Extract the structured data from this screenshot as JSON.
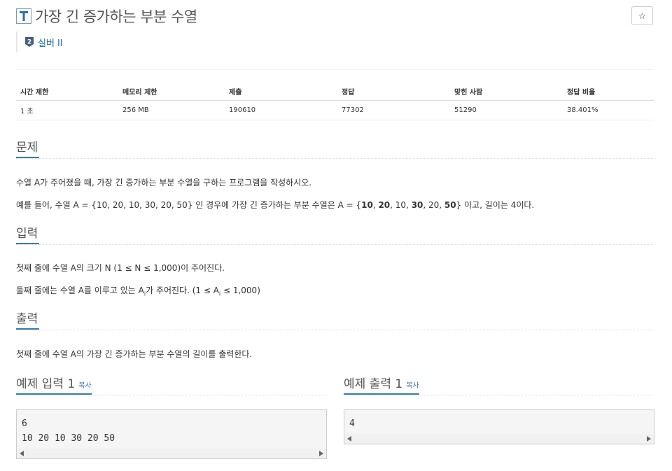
{
  "problem": {
    "title": "가장 긴 증가하는 부분 수열",
    "tier": "실버 II",
    "tier_number": "2",
    "star_glyph": "☆"
  },
  "info_table": {
    "headers": [
      "시간 제한",
      "메모리 제한",
      "제출",
      "정답",
      "맞힌 사람",
      "정답 비율"
    ],
    "values": [
      "1 초",
      "256 MB",
      "190610",
      "77302",
      "51290",
      "38.401%"
    ]
  },
  "sections": {
    "problem_heading": "문제",
    "problem_p1": "수열 A가 주어졌을 때, 가장 긴 증가하는 부분 수열을 구하는 프로그램을 작성하시오.",
    "problem_p2_prefix": "예를 들어, 수열 A = {10, 20, 10, 30, 20, 50} 인 경우에 가장 긴 증가하는 부분 수열은 A = {",
    "problem_p2_b1": "10",
    "problem_p2_s1": ", ",
    "problem_p2_b2": "20",
    "problem_p2_s2": ", 10, ",
    "problem_p2_b3": "30",
    "problem_p2_s3": ", 20, ",
    "problem_p2_b4": "50",
    "problem_p2_suffix": "} 이고, 길이는 4이다.",
    "input_heading": "입력",
    "input_p1": "첫째 줄에 수열 A의 크기 N (1 ≤ N ≤ 1,000)이 주어진다.",
    "input_p2_a": "둘째 줄에는 수열 A를 이루고 있는 A",
    "input_p2_sub1": "i",
    "input_p2_b": "가 주어진다. (1 ≤ A",
    "input_p2_sub2": "i",
    "input_p2_c": " ≤ 1,000)",
    "output_heading": "출력",
    "output_p1": "첫째 줄에 수열 A의 가장 긴 증가하는 부분 수열의 길이를 출력한다."
  },
  "samples": {
    "input_heading": "예제 입력 1",
    "output_heading": "예제 출력 1",
    "copy_label": "복사",
    "input_text": "6\n10 20 10 30 20 50",
    "output_text": "4"
  },
  "colors": {
    "accent": "#337ab7",
    "tier_silver": "#435f7a"
  }
}
